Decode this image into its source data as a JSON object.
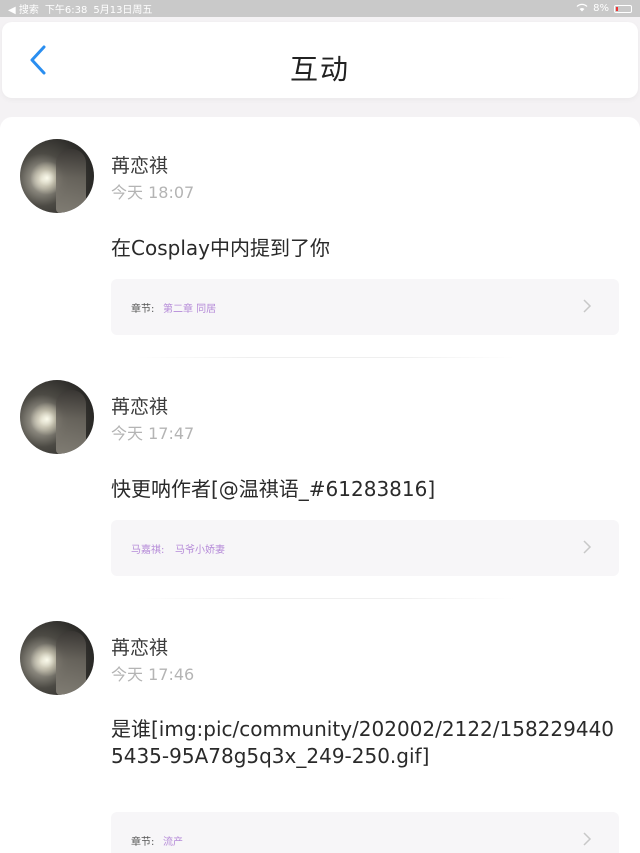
{
  "status_bar": {
    "back_app": "◀ 搜索",
    "time": "下午6:38",
    "date": "5月13日周五",
    "battery": "8%"
  },
  "nav": {
    "title": "互动",
    "back_icon": "chevron-left-icon",
    "accent_color": "#2a8ef0"
  },
  "items": [
    {
      "username": "苒恋祺",
      "time": "今天 18:07",
      "message": "在Cosplay中内提到了你",
      "chapter_label": "章节:",
      "chapter_value": "第二章 同居"
    },
    {
      "username": "苒恋祺",
      "time": "今天 17:47",
      "message": "快更呐作者[@温祺语_#61283816]",
      "chapter_label": "马嘉祺:",
      "chapter_value": "马爷小娇妻"
    },
    {
      "username": "苒恋祺",
      "time": "今天 17:46",
      "message": "是谁[img:pic/community/202002/2122/1582294405435-95A78g5q3x_249-250.gif]",
      "chapter_label": "章节:",
      "chapter_value": "流产"
    }
  ]
}
